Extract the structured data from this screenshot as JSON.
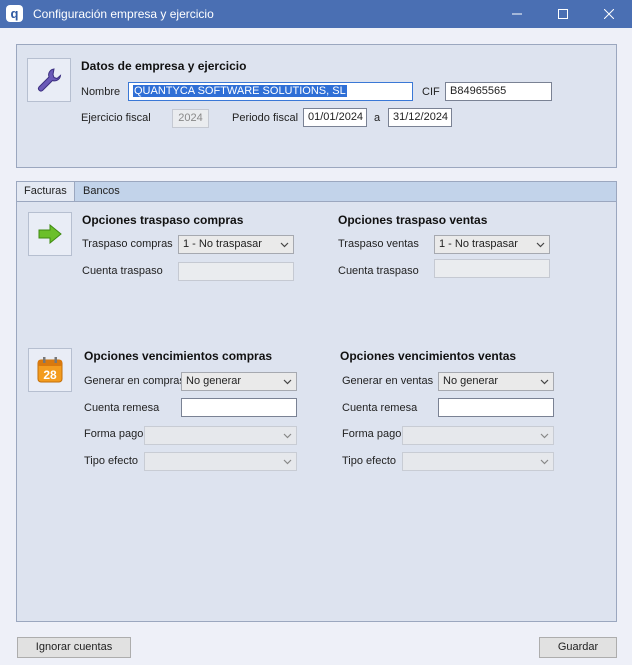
{
  "window": {
    "title": "Configuración empresa y ejercicio"
  },
  "company": {
    "heading": "Datos de empresa y ejercicio",
    "name_label": "Nombre",
    "name_value": "QUANTYCA SOFTWARE SOLUTIONS, SL",
    "cif_label": "CIF",
    "cif_value": "B84965565",
    "fiscal_year_label": "Ejercicio fiscal",
    "fiscal_year_value": "2024",
    "period_label": "Periodo fiscal",
    "period_from": "01/01/2024",
    "period_sep": "a",
    "period_to": "31/12/2024"
  },
  "tabs": [
    {
      "label": "Facturas",
      "active": true
    },
    {
      "label": "Bancos",
      "active": false
    }
  ],
  "transfer_purchases": {
    "heading": "Opciones traspaso compras",
    "mode_label": "Traspaso compras",
    "mode_value": "1 - No traspasar",
    "account_label": "Cuenta traspaso",
    "account_value": ""
  },
  "transfer_sales": {
    "heading": "Opciones traspaso ventas",
    "mode_label": "Traspaso ventas",
    "mode_value": "1 - No traspasar",
    "account_label": "Cuenta traspaso",
    "account_value": ""
  },
  "due_purchases": {
    "heading": "Opciones vencimientos compras",
    "generate_label": "Generar en compras",
    "generate_value": "No generar",
    "remittance_label": "Cuenta remesa",
    "remittance_value": "",
    "payment_label": "Forma pago",
    "payment_value": "",
    "effect_label": "Tipo efecto",
    "effect_value": ""
  },
  "due_sales": {
    "heading": "Opciones vencimientos ventas",
    "generate_label": "Generar en ventas",
    "generate_value": "No generar",
    "remittance_label": "Cuenta remesa",
    "remittance_value": "",
    "payment_label": "Forma pago",
    "payment_value": "",
    "effect_label": "Tipo efecto",
    "effect_value": ""
  },
  "calendar_icon_day": "28",
  "buttons": {
    "ignore": "Ignorar cuentas",
    "save": "Guardar"
  },
  "colors": {
    "titlebar": "#4a6fb3",
    "panel": "#dde3ef",
    "tabstrip": "#c2d3ea",
    "selection": "#2f6fd6",
    "arrow": "#6bbf2a",
    "calendar": "#f39c1f"
  }
}
